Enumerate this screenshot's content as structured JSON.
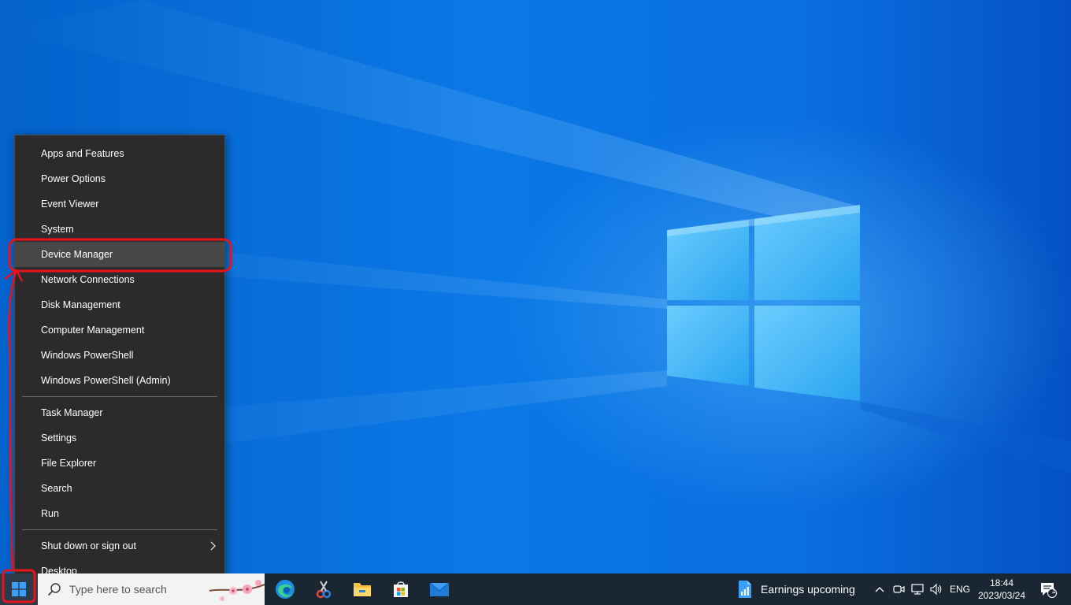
{
  "menu": {
    "group1": [
      {
        "label": "Apps and Features"
      },
      {
        "label": "Power Options"
      },
      {
        "label": "Event Viewer"
      },
      {
        "label": "System"
      },
      {
        "label": "Device Manager",
        "hover": true
      },
      {
        "label": "Network Connections"
      },
      {
        "label": "Disk Management"
      },
      {
        "label": "Computer Management"
      },
      {
        "label": "Windows PowerShell"
      },
      {
        "label": "Windows PowerShell (Admin)"
      }
    ],
    "group2": [
      {
        "label": "Task Manager"
      },
      {
        "label": "Settings"
      },
      {
        "label": "File Explorer"
      },
      {
        "label": "Search"
      },
      {
        "label": "Run"
      }
    ],
    "group3": [
      {
        "label": "Shut down or sign out",
        "has_submenu": true
      },
      {
        "label": "Desktop"
      }
    ]
  },
  "taskbar": {
    "search_placeholder": "Type here to search",
    "pinned_apps": [
      "edge-icon",
      "snipping-tool-icon",
      "file-explorer-icon",
      "microsoft-store-icon",
      "mail-icon"
    ],
    "news_widget": "Earnings upcoming",
    "language": "ENG",
    "time": "18:44",
    "date": "2023/03/24",
    "notification_count": "1"
  },
  "colors": {
    "menu_bg": "#2b2b2b",
    "menu_hover": "#474747",
    "taskbar_bg": "#1b2633",
    "annotation": "#e8141b",
    "wallpaper_blue": "#0a78e6"
  }
}
